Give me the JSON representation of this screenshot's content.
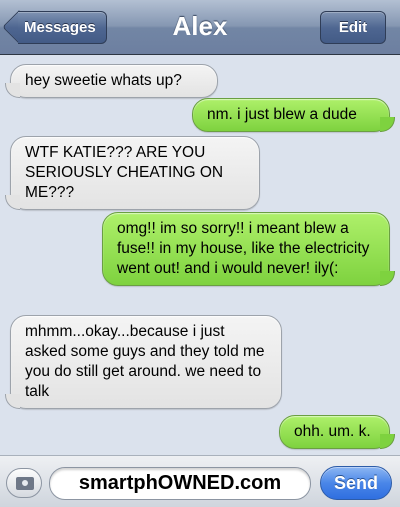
{
  "header": {
    "title": "Alex",
    "back_label": "Messages",
    "edit_label": "Edit"
  },
  "messages": [
    {
      "direction": "incoming",
      "text": "hey sweetie whats up?"
    },
    {
      "direction": "outgoing",
      "text": "nm. i just blew a dude"
    },
    {
      "direction": "incoming",
      "text": "WTF KATIE??? ARE YOU SERIOUSLY CHEATING ON ME???"
    },
    {
      "direction": "outgoing",
      "text": "omg!! im so sorry!! i meant blew a fuse!! in my house,  like the electricity went out! and i would never! ily(:"
    },
    {
      "direction": "incoming",
      "text": "mhmm...okay...because i just asked some guys and they told me you do still get around. we need to talk"
    },
    {
      "direction": "outgoing",
      "text": "ohh. um. k."
    }
  ],
  "input": {
    "value": "smartphOWNED.com",
    "send_label": "Send",
    "camera_icon": "camera-icon"
  },
  "colors": {
    "incoming_bubble": "#e9e9e9",
    "outgoing_bubble": "#8fdc4f",
    "navbar": "#7286a5",
    "send_button": "#4a86e8"
  }
}
